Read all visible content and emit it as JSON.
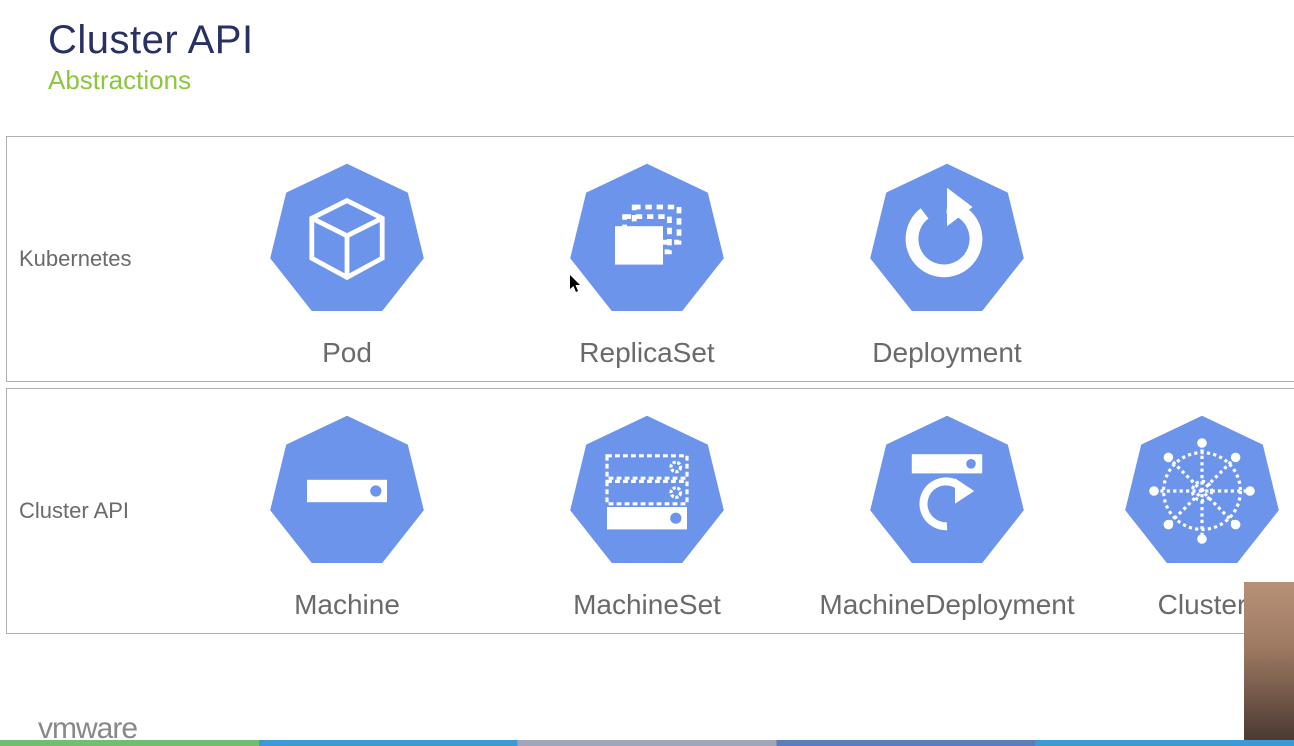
{
  "title": "Cluster API",
  "subtitle": "Abstractions",
  "rows": [
    {
      "label": "Kubernetes",
      "items": [
        {
          "label": "Pod",
          "icon": "cube"
        },
        {
          "label": "ReplicaSet",
          "icon": "stack"
        },
        {
          "label": "Deployment",
          "icon": "cycle"
        }
      ]
    },
    {
      "label": "Cluster API",
      "items": [
        {
          "label": "Machine",
          "icon": "bar"
        },
        {
          "label": "MachineSet",
          "icon": "bars"
        },
        {
          "label": "MachineDeployment",
          "icon": "barcycle"
        },
        {
          "label": "Cluster",
          "icon": "wheel"
        }
      ]
    }
  ],
  "footer": {
    "logo_bold": "vm",
    "logo_thin": "ware"
  },
  "colors": {
    "hept": "#6B94EA",
    "icon": "#FFFFFF"
  }
}
